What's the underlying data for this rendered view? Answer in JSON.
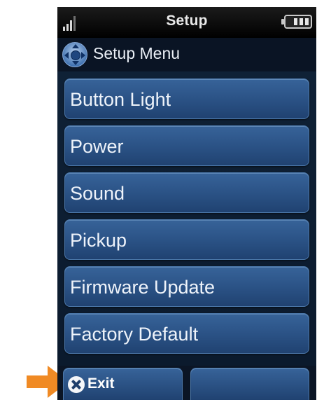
{
  "status_bar": {
    "title": "Setup",
    "signal_icon": "signal-bars-icon",
    "battery_icon": "battery-icon"
  },
  "header": {
    "icon": "navigation-pad-icon",
    "title": "Setup Menu"
  },
  "menu": {
    "items": [
      {
        "label": "Button Light"
      },
      {
        "label": "Power"
      },
      {
        "label": "Sound"
      },
      {
        "label": "Pickup"
      },
      {
        "label": "Firmware Update"
      },
      {
        "label": "Factory Default"
      }
    ]
  },
  "softkeys": {
    "left": {
      "label": "Exit",
      "icon": "close-icon"
    },
    "right": {
      "label": ""
    }
  },
  "callout": {
    "icon": "arrow-right-icon",
    "color": "#f08a24"
  },
  "colors": {
    "button_blue": "#2a5184",
    "screen_background": "#050a12",
    "text": "#eef3fa"
  }
}
